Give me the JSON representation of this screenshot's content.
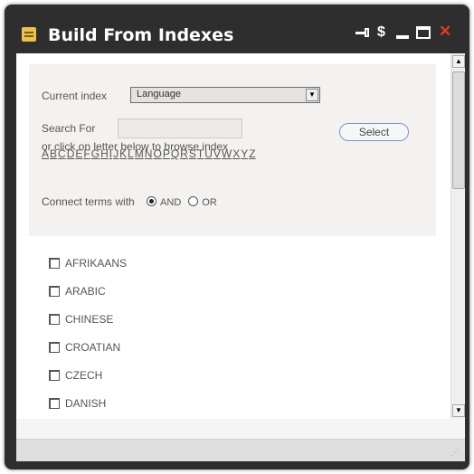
{
  "window": {
    "title": "Build From Indexes",
    "controls": {
      "pin_icon": "pin-icon",
      "refresh_icon": "refresh-icon",
      "refresh_glyph": "$",
      "minimize_icon": "minimize-icon",
      "maximize_icon": "maximize-icon",
      "close_icon": "close-icon",
      "close_glyph": "✕"
    },
    "colors": {
      "titlebar": "#2e2e2e",
      "close": "#e53b1f",
      "button_border": "#7b95c5"
    }
  },
  "form": {
    "current_index_label": "Current index",
    "current_index_value": "Language",
    "search_label": "Search For",
    "search_value": "",
    "select_button": "Select",
    "browse_hint": "or click on letter below to browse index",
    "letters": [
      "A",
      "B",
      "C",
      "D",
      "E",
      "F",
      "G",
      "H",
      "I",
      "J",
      "K",
      "L",
      "M",
      "N",
      "O",
      "P",
      "Q",
      "R",
      "S",
      "T",
      "U",
      "V",
      "W",
      "X",
      "Y",
      "Z"
    ],
    "connect_label": "Connect terms with",
    "connect_options": [
      {
        "label": "AND",
        "selected": true
      },
      {
        "label": "OR",
        "selected": false
      }
    ]
  },
  "languages": [
    {
      "label": "AFRIKAANS",
      "checked": false
    },
    {
      "label": "ARABIC",
      "checked": false
    },
    {
      "label": "CHINESE",
      "checked": false
    },
    {
      "label": "CROATIAN",
      "checked": false
    },
    {
      "label": "CZECH",
      "checked": false
    },
    {
      "label": "DANISH",
      "checked": false
    }
  ]
}
